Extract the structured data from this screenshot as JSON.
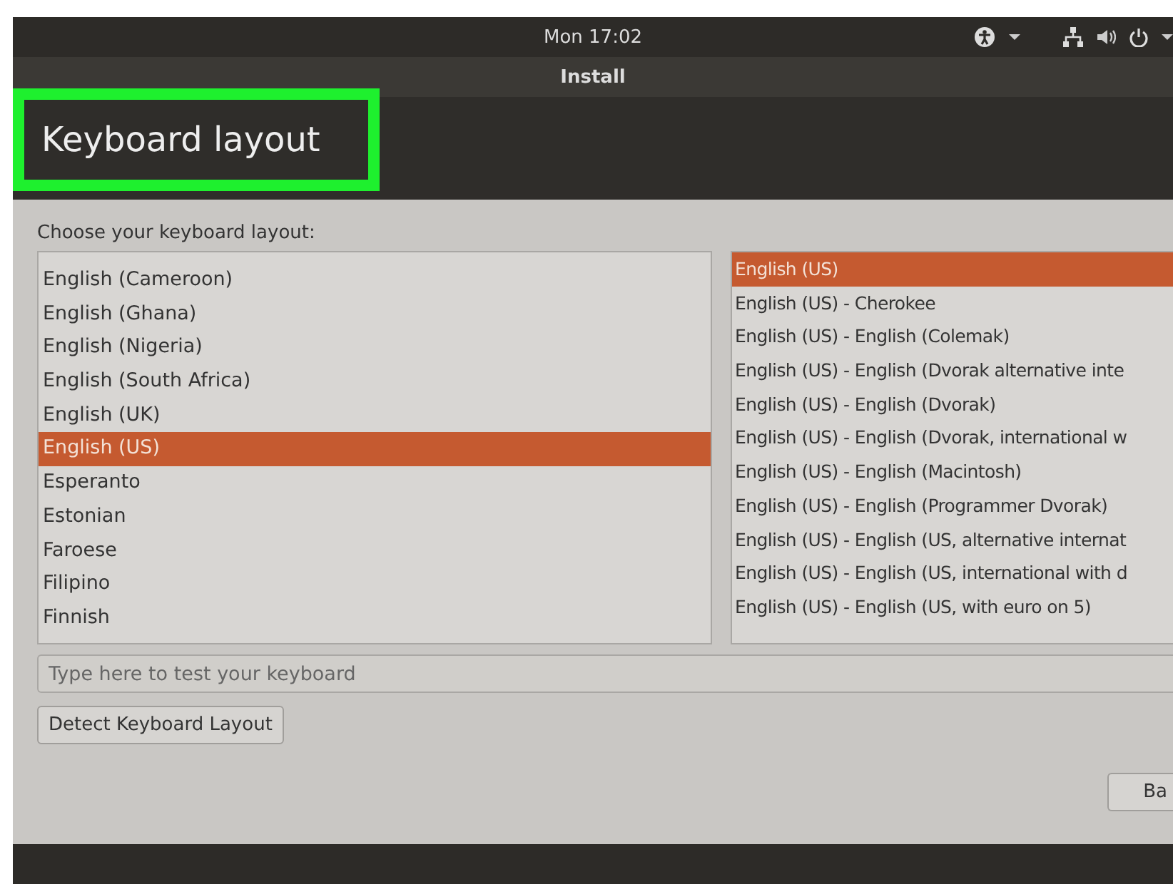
{
  "top_bar": {
    "clock": "Mon 17:02"
  },
  "window": {
    "title": "Install"
  },
  "header": {
    "title": "Keyboard layout",
    "highlighted": true
  },
  "prompt": "Choose your keyboard layout:",
  "layouts": [
    {
      "label": "English (Cameroon)",
      "selected": false
    },
    {
      "label": "English (Ghana)",
      "selected": false
    },
    {
      "label": "English (Nigeria)",
      "selected": false
    },
    {
      "label": "English (South Africa)",
      "selected": false
    },
    {
      "label": "English (UK)",
      "selected": false
    },
    {
      "label": "English (US)",
      "selected": true
    },
    {
      "label": "Esperanto",
      "selected": false
    },
    {
      "label": "Estonian",
      "selected": false
    },
    {
      "label": "Faroese",
      "selected": false
    },
    {
      "label": "Filipino",
      "selected": false
    },
    {
      "label": "Finnish",
      "selected": false
    }
  ],
  "variants": [
    {
      "label": "English (US)",
      "selected": true
    },
    {
      "label": "English (US) - Cherokee",
      "selected": false
    },
    {
      "label": "English (US) - English (Colemak)",
      "selected": false
    },
    {
      "label": "English (US) - English (Dvorak alternative inte",
      "selected": false
    },
    {
      "label": "English (US) - English (Dvorak)",
      "selected": false
    },
    {
      "label": "English (US) - English (Dvorak, international w",
      "selected": false
    },
    {
      "label": "English (US) - English (Macintosh)",
      "selected": false
    },
    {
      "label": "English (US) - English (Programmer Dvorak)",
      "selected": false
    },
    {
      "label": "English (US) - English (US, alternative internat",
      "selected": false
    },
    {
      "label": "English (US) - English (US, international with d",
      "selected": false
    },
    {
      "label": "English (US) - English (US, with euro on 5)",
      "selected": false
    }
  ],
  "test_field": {
    "placeholder": "Type here to test your keyboard"
  },
  "detect_button": "Detect Keyboard Layout",
  "back_button": "Ba"
}
